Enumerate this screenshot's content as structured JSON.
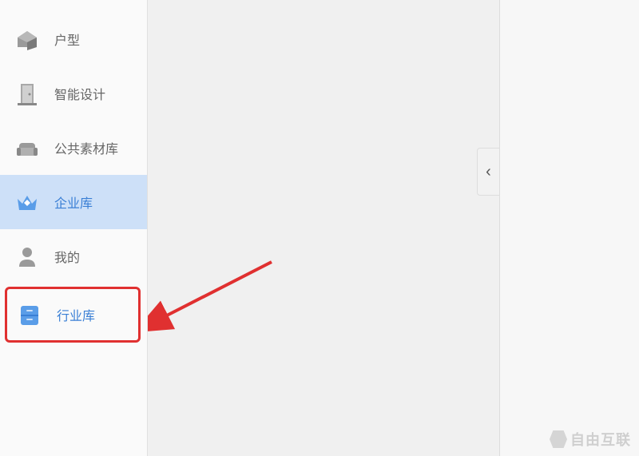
{
  "sidebar": {
    "items": [
      {
        "label": "户型",
        "icon": "floorplan-icon"
      },
      {
        "label": "智能设计",
        "icon": "door-icon"
      },
      {
        "label": "公共素材库",
        "icon": "sofa-icon"
      },
      {
        "label": "企业库",
        "icon": "crown-icon"
      },
      {
        "label": "我的",
        "icon": "person-icon"
      },
      {
        "label": "行业库",
        "icon": "cabinet-icon"
      }
    ]
  },
  "collapse": {
    "symbol": "‹"
  },
  "watermark": {
    "text": "自由互联"
  },
  "annotation": {
    "highlight_index": 5,
    "selected_index": 3
  }
}
